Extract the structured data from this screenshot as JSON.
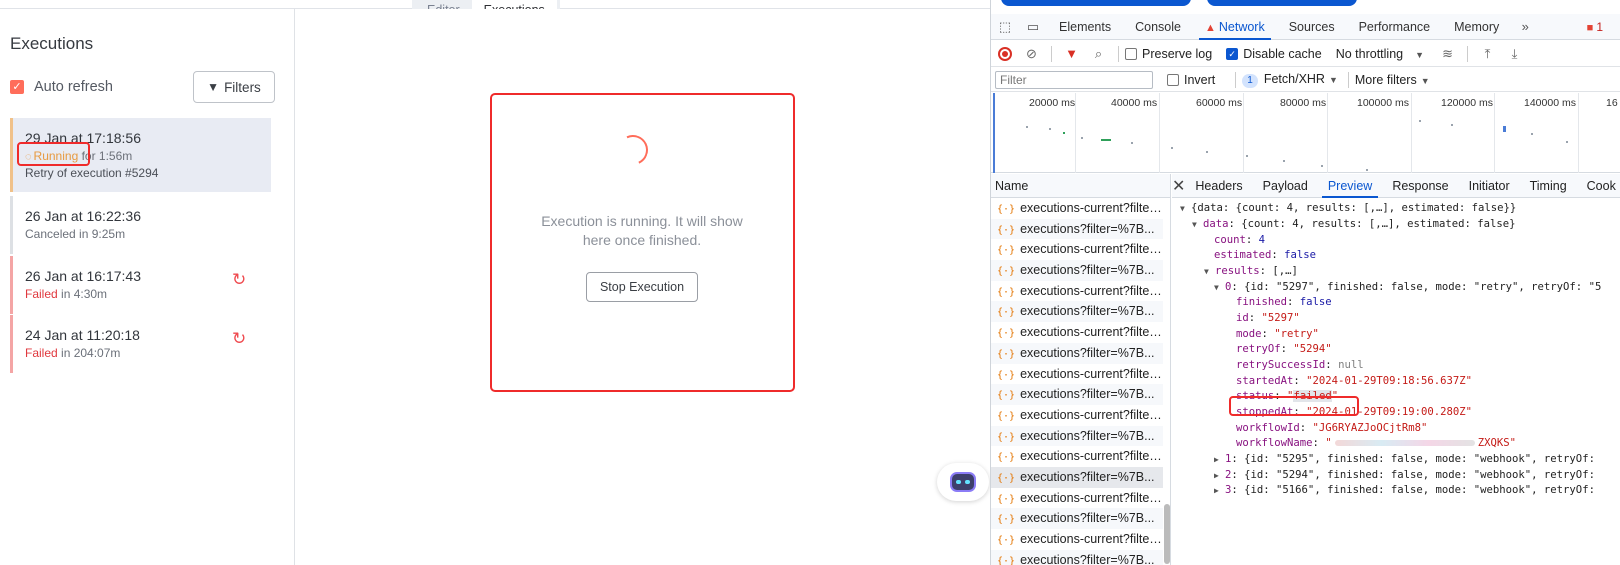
{
  "app": {
    "mode_tabs": [
      "Editor",
      "Executions"
    ],
    "sidebar": {
      "title": "Executions",
      "auto_refresh_label": "Auto refresh",
      "filters_label": "Filters",
      "executions": [
        {
          "date": "29 Jan at 17:18:56",
          "status": "Running",
          "status_suffix": " for 1:56m",
          "extra": "Retry of execution #5294"
        },
        {
          "date": "26 Jan at 16:22:36",
          "status": "Canceled",
          "status_suffix": " in 9:25m"
        },
        {
          "date": "26 Jan at 16:17:43",
          "status": "Failed",
          "status_suffix": " in 4:30m"
        },
        {
          "date": "24 Jan at 11:20:18",
          "status": "Failed",
          "status_suffix": " in 204:07m"
        }
      ]
    },
    "main": {
      "running_message": "Execution is running. It will show here once finished.",
      "stop_button": "Stop Execution"
    },
    "colors": {
      "accent": "#ff6d5a",
      "running": "#e79a40",
      "failed": "#e0383e",
      "annotation": "#ef2b2b"
    }
  },
  "devtools": {
    "tabs": [
      "Elements",
      "Console",
      "Network",
      "Sources",
      "Performance",
      "Memory"
    ],
    "more_tabs": "»",
    "issues_count": "1",
    "toolbar": {
      "preserve_log": "Preserve log",
      "disable_cache": "Disable cache",
      "throttling": "No throttling"
    },
    "filterbar": {
      "filter_placeholder": "Filter",
      "invert": "Invert",
      "fetch_count": "1",
      "fetch_xhr": "Fetch/XHR",
      "more_filters": "More filters"
    },
    "timeline_ticks": [
      "20000 ms",
      "40000 ms",
      "60000 ms",
      "80000 ms",
      "100000 ms",
      "120000 ms",
      "140000 ms",
      "16"
    ],
    "name_header": "Name",
    "requests": [
      "executions-current?filter...",
      "executions?filter=%7B...",
      "executions-current?filter...",
      "executions?filter=%7B...",
      "executions-current?filter...",
      "executions?filter=%7B...",
      "executions-current?filter...",
      "executions?filter=%7B...",
      "executions-current?filter...",
      "executions?filter=%7B...",
      "executions-current?filter...",
      "executions?filter=%7B...",
      "executions-current?filter...",
      "executions?filter=%7B...",
      "executions-current?filter...",
      "executions?filter=%7B...",
      "executions-current?filter...",
      "executions?filter=%7B..."
    ],
    "detail_tabs": [
      "Headers",
      "Payload",
      "Preview",
      "Response",
      "Initiator",
      "Timing",
      "Cook"
    ],
    "json": {
      "root": "{data: {count: 4, results: [,…], estimated: false}}",
      "data": "{count: 4, results: [,…], estimated: false}",
      "count": "4",
      "estimated": "false",
      "results": "[,…]",
      "r0_summary": "{id: \"5297\", finished: false, mode: \"retry\", retryOf: \"5",
      "finished": "false",
      "id": "\"5297\"",
      "mode": "\"retry\"",
      "retryOf": "\"5294\"",
      "retrySuccessId": "null",
      "startedAt": "\"2024-01-29T09:18:56.637Z\"",
      "status": "failed",
      "stoppedAt": "\"2024-01-29T09:19:00.280Z\"",
      "workflowId": "\"JG6RYAZJoOCjtRm8\"",
      "workflowName_start": "\"",
      "workflowName_end": "ZXQKS\"",
      "r1_summary": "{id: \"5295\", finished: false, mode: \"webhook\", retryOf:",
      "r2_summary": "{id: \"5294\", finished: false, mode: \"webhook\", retryOf:",
      "r3_summary": "{id: \"5166\", finished: false, mode: \"webhook\", retryOf:"
    }
  }
}
